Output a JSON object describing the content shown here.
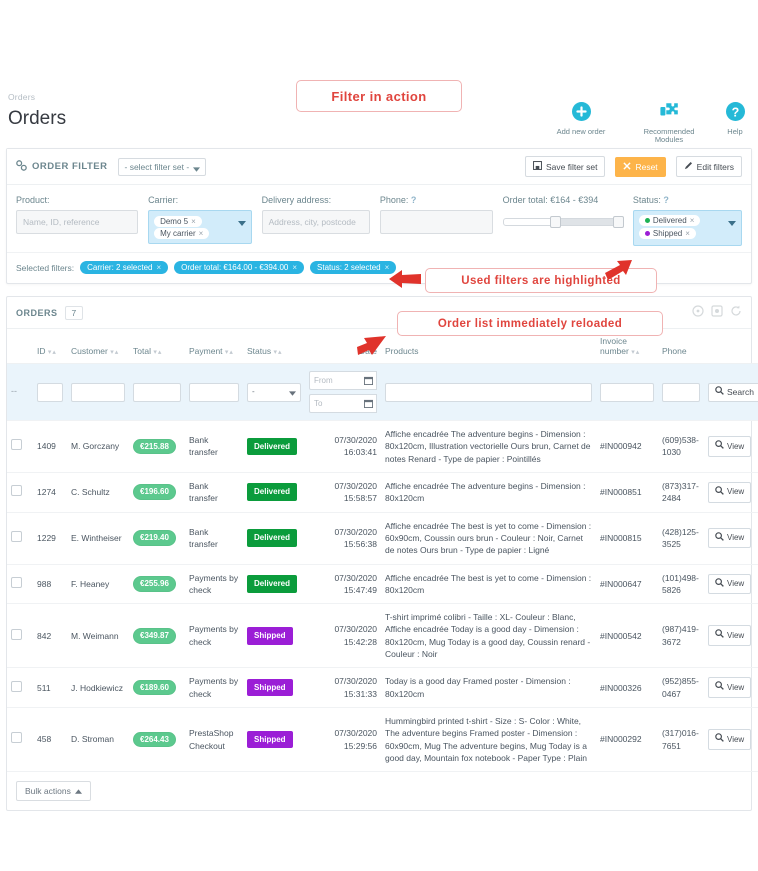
{
  "header": {
    "breadcrumb": "Orders",
    "title": "Orders",
    "actions": [
      {
        "icon": "add-circle-icon",
        "label": "Add new order"
      },
      {
        "icon": "puzzle-piece-icon",
        "label": "Recommended Modules"
      },
      {
        "icon": "question-circle-icon",
        "label": "Help"
      }
    ]
  },
  "annotations": [
    {
      "id": "filter-in-action",
      "text": "Filter in action"
    },
    {
      "id": "used-filters",
      "text": "Used filters are highlighted"
    },
    {
      "id": "list-reloaded",
      "text": "Order list immediately reloaded"
    }
  ],
  "filter_panel": {
    "title": "ORDER FILTER",
    "filter_set_select": "- select filter set -",
    "buttons": {
      "save": "Save filter set",
      "reset": "Reset",
      "edit": "Edit filters"
    },
    "fields": {
      "product": {
        "label": "Product:",
        "placeholder": "Name, ID, reference",
        "value": ""
      },
      "carrier": {
        "label": "Carrier:",
        "tags": [
          "Demo 5",
          "My carrier"
        ]
      },
      "delivery_address": {
        "label": "Delivery address:",
        "placeholder": "Address, city, postcode",
        "value": ""
      },
      "phone": {
        "label": "Phone:",
        "help": "?",
        "value": ""
      },
      "order_total": {
        "label": "Order total: €164 - €394",
        "min": 164,
        "max": 394
      },
      "status": {
        "label": "Status:",
        "help": "?",
        "tags": [
          {
            "text": "Delivered",
            "color": "#1db255"
          },
          {
            "text": "Shipped",
            "color": "#9b1ed6"
          }
        ]
      }
    },
    "selected_filters": {
      "label": "Selected filters:",
      "pills": [
        "Carrier: 2 selected",
        "Order total: €164.00 - €394.00",
        "Status: 2 selected"
      ],
      "pill_color": "#2ab4e2"
    }
  },
  "orders_panel": {
    "title": "ORDERS",
    "count": "7",
    "head_icons": [
      "help-circle-icon",
      "export-icon",
      "refresh-icon"
    ],
    "columns": [
      "ID",
      "Customer",
      "Total",
      "Payment",
      "Status",
      "Date",
      "Products",
      "Invoice number",
      "Phone"
    ],
    "search_row": {
      "status_select": "-",
      "date_from_placeholder": "From",
      "date_to_placeholder": "To",
      "search_label": "Search"
    },
    "view_label": "View",
    "bulk_actions_label": "Bulk actions",
    "rows": [
      {
        "id": "1409",
        "customer": "M. Gorczany",
        "total": "€215.88",
        "payment": "Bank transfer",
        "status": "Delivered",
        "date": "07/30/2020",
        "time": "16:03:41",
        "products": "Affiche encadrée The adventure begins - Dimension : 80x120cm, Illustration vectorielle Ours brun, Carnet de notes Renard - Type de papier : Pointillés",
        "invoice": "#IN000942",
        "phone": "(609)538-1030"
      },
      {
        "id": "1274",
        "customer": "C. Schultz",
        "total": "€196.60",
        "payment": "Bank transfer",
        "status": "Delivered",
        "date": "07/30/2020",
        "time": "15:58:57",
        "products": "Affiche encadrée The adventure begins - Dimension : 80x120cm",
        "invoice": "#IN000851",
        "phone": "(873)317-2484"
      },
      {
        "id": "1229",
        "customer": "E. Wintheiser",
        "total": "€219.40",
        "payment": "Bank transfer",
        "status": "Delivered",
        "date": "07/30/2020",
        "time": "15:56:38",
        "products": "Affiche encadrée The best is yet to come - Dimension : 60x90cm, Coussin ours brun - Couleur : Noir, Carnet de notes Ours brun - Type de papier : Ligné",
        "invoice": "#IN000815",
        "phone": "(428)125-3525"
      },
      {
        "id": "988",
        "customer": "F. Heaney",
        "total": "€255.96",
        "payment": "Payments by check",
        "status": "Delivered",
        "date": "07/30/2020",
        "time": "15:47:49",
        "products": "Affiche encadrée The best is yet to come - Dimension : 80x120cm",
        "invoice": "#IN000647",
        "phone": "(101)498-5826"
      },
      {
        "id": "842",
        "customer": "M. Weimann",
        "total": "€349.87",
        "payment": "Payments by check",
        "status": "Shipped",
        "date": "07/30/2020",
        "time": "15:42:28",
        "products": "T-shirt imprimé colibri - Taille : XL- Couleur : Blanc, Affiche encadrée Today is a good day - Dimension : 80x120cm, Mug Today is a good day, Coussin renard - Couleur : Noir",
        "invoice": "#IN000542",
        "phone": "(987)419-3672"
      },
      {
        "id": "511",
        "customer": "J. Hodkiewicz",
        "total": "€189.60",
        "payment": "Payments by check",
        "status": "Shipped",
        "date": "07/30/2020",
        "time": "15:31:33",
        "products": "Today is a good day Framed poster - Dimension : 80x120cm",
        "invoice": "#IN000326",
        "phone": "(952)855-0467"
      },
      {
        "id": "458",
        "customer": "D. Stroman",
        "total": "€264.43",
        "payment": "PrestaShop Checkout",
        "status": "Shipped",
        "date": "07/30/2020",
        "time": "15:29:56",
        "products": "Hummingbird printed t-shirt - Size : S- Color : White, The adventure begins Framed poster - Dimension : 60x90cm, Mug The adventure begins, Mug Today is a good day, Mountain fox notebook - Paper Type : Plain",
        "invoice": "#IN000292",
        "phone": "(317)016-7651"
      }
    ]
  }
}
